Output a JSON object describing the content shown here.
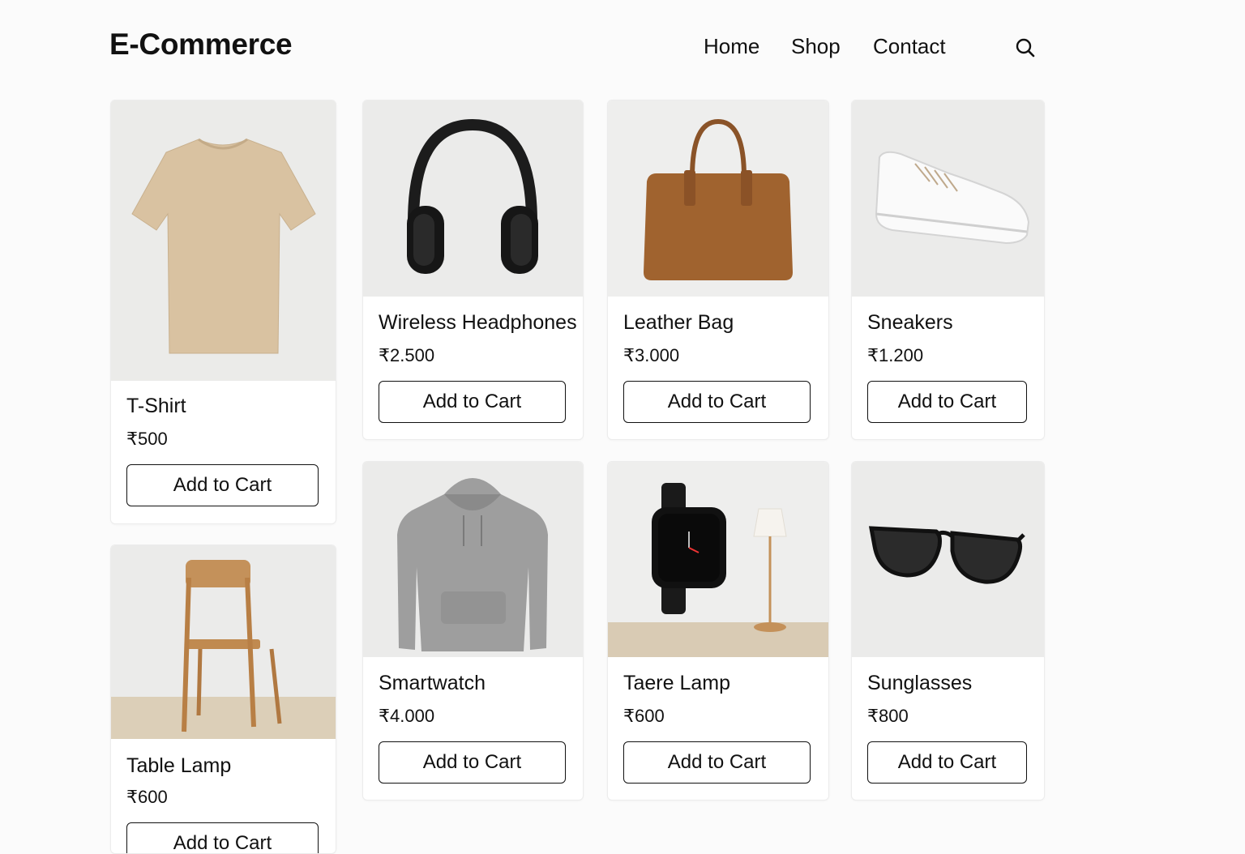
{
  "header": {
    "logo": "E-Commerce",
    "nav": [
      "Home",
      "Shop",
      "Contact"
    ],
    "search_icon": "search-icon"
  },
  "products": [
    {
      "name": "T-Shirt",
      "price": "₹500",
      "button": "Add to Cart",
      "image": "t-shirt"
    },
    {
      "name": "Wireless Headphones",
      "price": "₹2.500",
      "button": "Add to Cart",
      "image": "headphones"
    },
    {
      "name": "Leather Bag",
      "price": "₹3.000",
      "button": "Add to Cart",
      "image": "leather-bag"
    },
    {
      "name": "Sneakers",
      "price": "₹1.200",
      "button": "Add to Cart",
      "image": "sneakers"
    },
    {
      "name": "Table Lamp",
      "price": "₹600",
      "button": "Add to Cart",
      "image": "chair"
    },
    {
      "name": "Smartwatch",
      "price": "₹4.000",
      "button": "Add to Cart",
      "image": "hoodie"
    },
    {
      "name": "Taere Lamp",
      "price": "₹600",
      "button": "Add to Cart",
      "image": "smartwatch-and-lamp"
    },
    {
      "name": "Sunglasses",
      "price": "₹800",
      "button": "Add to Cart",
      "image": "sunglasses"
    }
  ]
}
